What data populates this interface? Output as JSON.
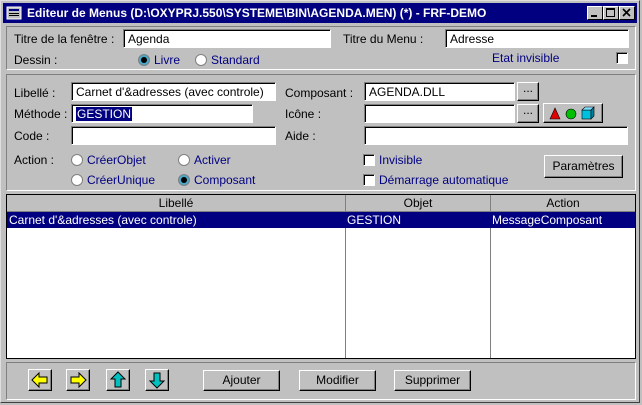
{
  "window": {
    "title": "Editeur de Menus (D:\\OXYPRJ.550\\SYSTEME\\BIN\\AGENDA.MEN) (*) - FRF-DEMO"
  },
  "top": {
    "titre_fenetre_label": "Titre de la fenêtre :",
    "titre_fenetre_value": "Agenda",
    "titre_menu_label": "Titre du Menu :",
    "titre_menu_value": "Adresse",
    "dessin_label": "Dessin :",
    "dessin_options": [
      "Livre",
      "Standard"
    ],
    "etat_invisible_label": "Etat invisible"
  },
  "item": {
    "libelle_label": "Libellé :",
    "libelle_value": "Carnet d'&adresses (avec controle)",
    "methode_label": "Méthode :",
    "methode_value": "GESTION",
    "code_label": "Code :",
    "code_value": "",
    "composant_label": "Composant :",
    "composant_value": "AGENDA.DLL",
    "icone_label": "Icône :",
    "icone_value": "",
    "aide_label": "Aide :",
    "aide_value": "",
    "browse_label": "...",
    "action_label": "Action :",
    "action_options": [
      "CréerObjet",
      "Activer",
      "CréerUnique",
      "Composant"
    ],
    "invisible_label": "Invisible",
    "demarrage_label": "Démarrage automatique",
    "parametres_label": "Paramètres"
  },
  "table": {
    "columns": [
      "Libellé",
      "Objet",
      "Action"
    ],
    "rows": [
      [
        "Carnet d'&adresses (avec controle)",
        "GESTION",
        "MessageComposant"
      ]
    ]
  },
  "footer": {
    "ajouter": "Ajouter",
    "modifier": "Modifier",
    "supprimer": "Supprimer"
  },
  "colors": {
    "titlebar": "#000080",
    "face": "#c0c0c0",
    "label_blue": "#000080",
    "arrow_yellow": "#ffff00",
    "arrow_cyan": "#00c0c0"
  }
}
